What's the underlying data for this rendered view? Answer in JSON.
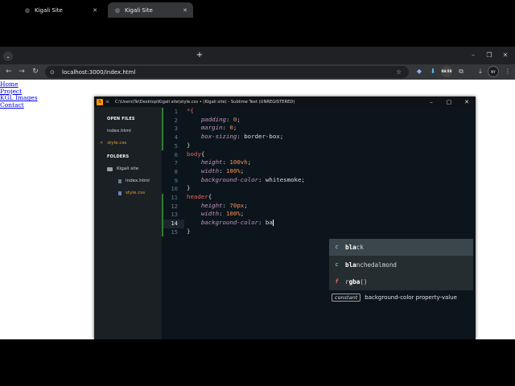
{
  "browser": {
    "tabs": [
      {
        "label": "Kigali Site",
        "close": "✕",
        "active": false
      },
      {
        "label": "Kigali Site",
        "close": "✕",
        "active": true
      }
    ],
    "new_tab": "+",
    "url": "localhost:3000/index.html",
    "window_controls": {
      "minimize": "–",
      "restore": "❐",
      "close": "✕"
    },
    "download_badge": "04:50",
    "avatar_text": "NY"
  },
  "page": {
    "links": [
      "Home",
      "Project",
      "KGL Images",
      "Contact"
    ]
  },
  "sublime": {
    "title": "C:\\Users\\Te\\Desktop\\Kigali site\\style.css • (Kigali site) - Sublime Text (UNREGISTERED)",
    "sidebar": {
      "open_files_header": "OPEN FILES",
      "open_files": [
        "index.html",
        "style.css"
      ],
      "folders_header": "FOLDERS",
      "folder_name": "Kigali site",
      "folder_files": [
        "index.html",
        "style.css"
      ]
    },
    "line_numbers": [
      "1",
      "2",
      "3",
      "4",
      "5",
      "6",
      "7",
      "8",
      "9",
      "10",
      "11",
      "12",
      "13",
      "14",
      "15"
    ],
    "current_line": "14",
    "code": {
      "l1_sel": "*{",
      "l2_prop": "padding",
      "l2_val": "0",
      "l3_prop": "margin",
      "l3_val": "0",
      "l4_prop": "box-sizing",
      "l4_val": "border-box",
      "l5": "}",
      "l6_sel": "body",
      "l6_brace": "{",
      "l7_prop": "height",
      "l7_val": "100vh",
      "l8_prop": "width",
      "l8_val": "100%",
      "l9_prop": "background-color",
      "l9_val": "whitesmoke",
      "l10": "}",
      "l11_sel": "header",
      "l11_brace": "{",
      "l12_prop": "height",
      "l12_val": "70px",
      "l13_prop": "width",
      "l13_val": "100%",
      "l14_prop": "background-color",
      "l14_val": "ba",
      "l15": "}"
    },
    "autocomplete": {
      "items": [
        {
          "kind": "c",
          "match": "bla",
          "rest": "ck"
        },
        {
          "kind": "c",
          "match": "bla",
          "rest": "nchedalmond"
        },
        {
          "kind": "f",
          "match_pre": "r",
          "match": "gba",
          "rest": "()"
        }
      ],
      "footer_tag": "constant",
      "footer_text": "background-color property-value"
    }
  }
}
